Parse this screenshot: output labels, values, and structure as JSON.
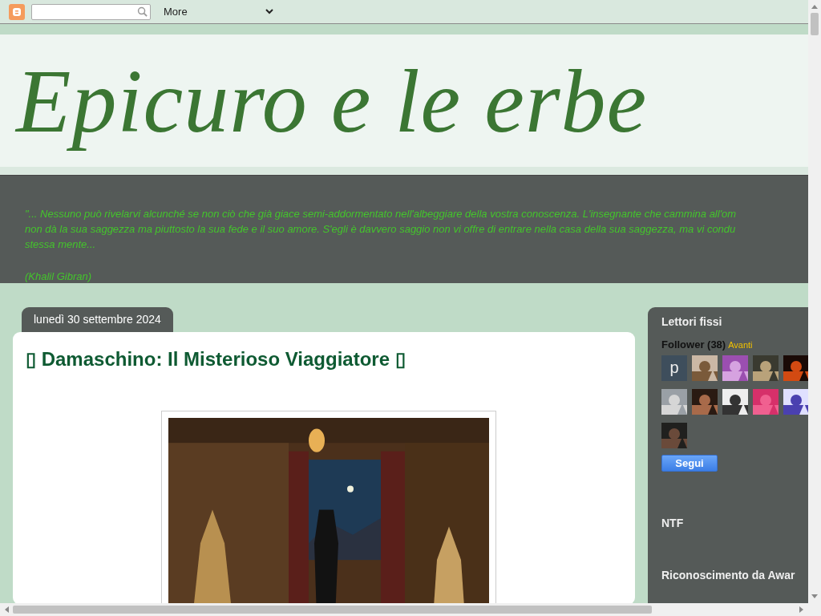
{
  "navbar": {
    "more_label": "More"
  },
  "header": {
    "title": "Epicuro e le erbe"
  },
  "description": {
    "lines": [
      "\"... Nessuno può rivelarvi alcunché se non ciò che già giace semi-addormentato nell'albeggiare della vostra conoscenza. L'insegnante che cammina all'om",
      "non dà la sua saggezza ma piuttosto la sua fede e il suo amore. S'egli è davvero saggio non vi offre di entrare nella casa della sua saggezza, ma vi condu",
      "stessa mente..."
    ],
    "attribution": "(Khalil Gibran)"
  },
  "post": {
    "date": "lunedì 30 settembre 2024",
    "title": "▯ Damaschino: Il Misterioso Viaggiatore ▯",
    "image": {
      "kind": "picture"
    }
  },
  "sidebar": {
    "widgets": [
      {
        "kind": "followers",
        "title": "Lettori fissi",
        "label": "Follower (38)",
        "link": "Avanti",
        "button": "Segui",
        "followers": [
          {
            "kind": "letter",
            "letter": "p"
          },
          {
            "kind": "picture"
          },
          {
            "kind": "picture"
          },
          {
            "kind": "picture"
          },
          {
            "kind": "picture"
          },
          {
            "kind": "picture"
          },
          {
            "kind": "picture"
          },
          {
            "kind": "picture"
          },
          {
            "kind": "picture"
          },
          {
            "kind": "picture"
          },
          {
            "kind": "picture"
          }
        ]
      },
      {
        "kind": "plain",
        "title": "NTF"
      },
      {
        "kind": "plain",
        "title": "Riconoscimento da Awar"
      }
    ]
  }
}
